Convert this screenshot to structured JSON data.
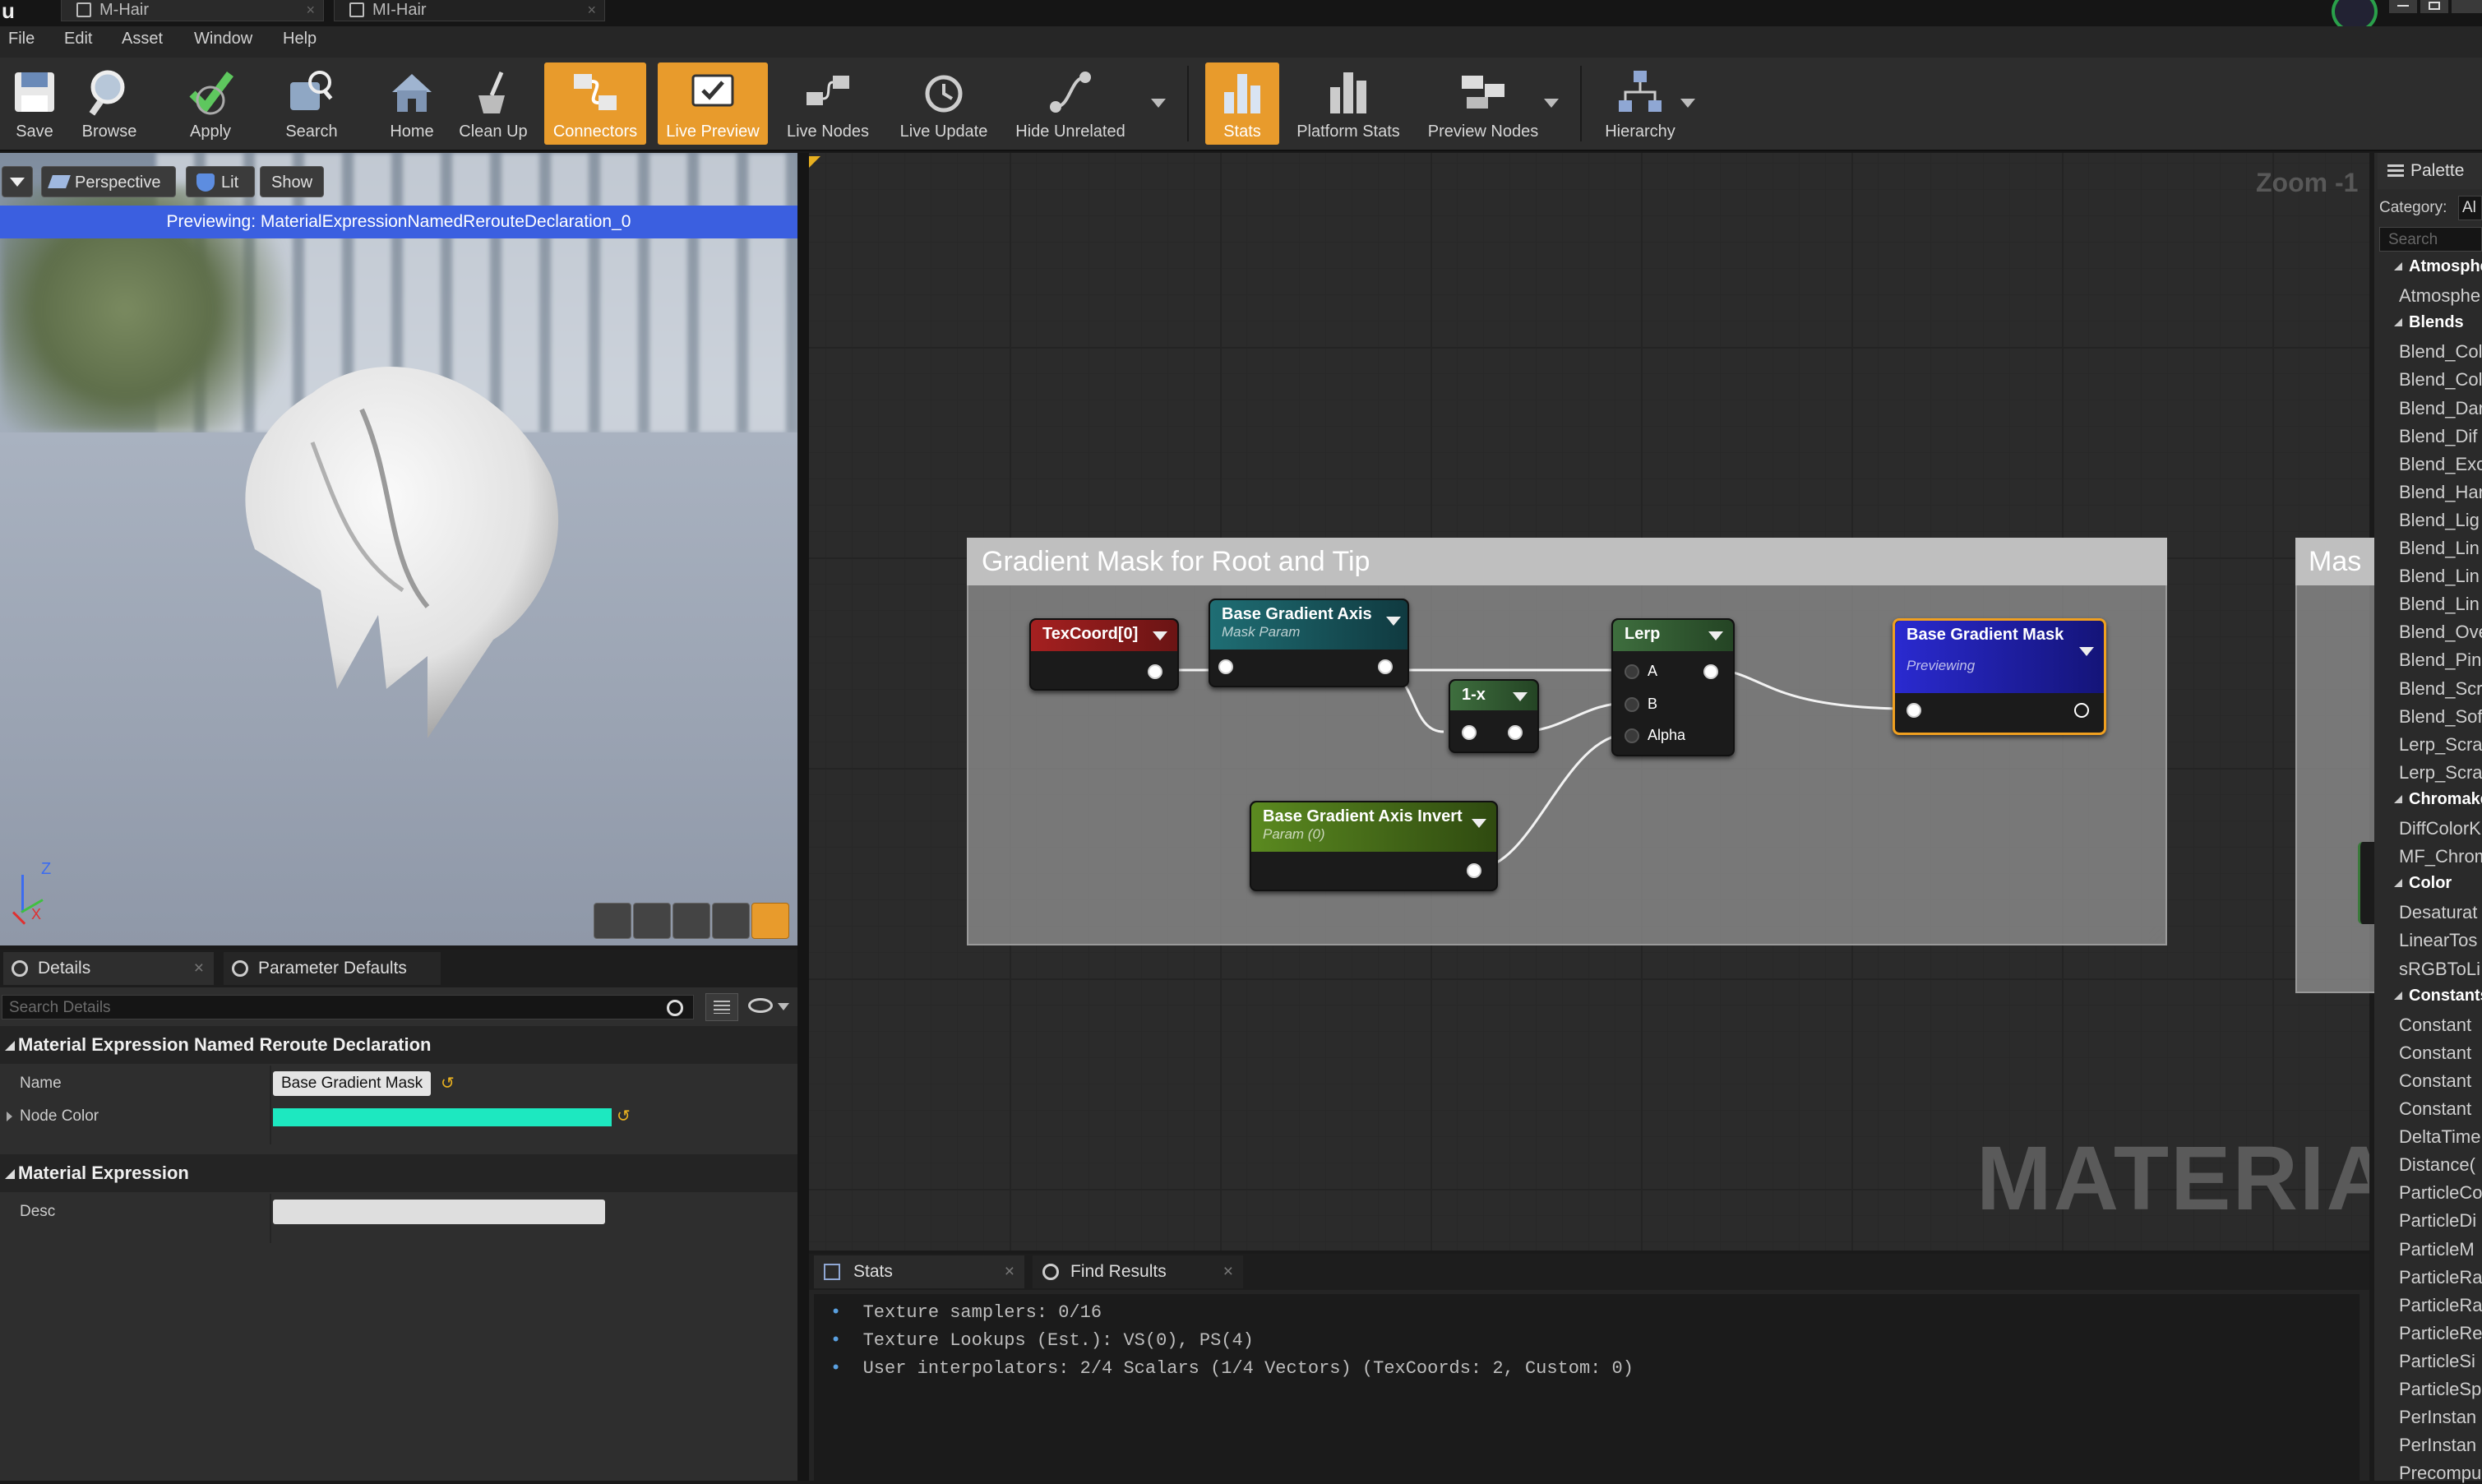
{
  "window": {
    "tabs": [
      "M-Hair",
      "MI-Hair"
    ]
  },
  "menu": [
    "File",
    "Edit",
    "Asset",
    "Window",
    "Help"
  ],
  "toolbar": {
    "items": [
      "Save",
      "Browse",
      "Apply",
      "Search",
      "Home",
      "Clean Up",
      "Connectors",
      "Live Preview",
      "Live Nodes",
      "Live Update",
      "Hide Unrelated",
      "Stats",
      "Platform Stats",
      "Preview Nodes",
      "Hierarchy"
    ],
    "active": [
      "Connectors",
      "Live Preview",
      "Stats"
    ],
    "accent": "#e89b2c"
  },
  "viewport": {
    "perspective": "Perspective",
    "lit": "Lit",
    "show": "Show",
    "previewing": "Previewing: MaterialExpressionNamedRerouteDeclaration_0",
    "axis_z": "Z",
    "axis_x": "X"
  },
  "details": {
    "tab_details": "Details",
    "tab_params": "Parameter Defaults",
    "search_placeholder": "Search Details",
    "cat1": "Material Expression Named Reroute Declaration",
    "name_label": "Name",
    "name_value": "Base Gradient Mask",
    "node_color_label": "Node Color",
    "node_color": "#1de8c0",
    "cat2": "Material Expression",
    "desc_label": "Desc"
  },
  "graph": {
    "zoom": "Zoom -1",
    "watermark": "MATERIAL",
    "comment": "Gradient Mask for Root and Tip",
    "comment2": "Mas",
    "nodes": {
      "texcoord": "TexCoord[0]",
      "bga": "Base Gradient Axis",
      "bga_sub": "Mask Param",
      "onex": "1-x",
      "lerp": "Lerp",
      "lerp_a": "A",
      "lerp_b": "B",
      "lerp_alpha": "Alpha",
      "bgm": "Base Gradient Mask",
      "bgm_sub": "Previewing",
      "bgai": "Base Gradient Axis Invert",
      "bgai_sub": "Param (0)"
    }
  },
  "stats": {
    "tab_stats": "Stats",
    "tab_find": "Find Results",
    "lines": [
      "Texture samplers: 0/16",
      "Texture Lookups (Est.): VS(0), PS(4)",
      "User interpolators: 2/4 Scalars (1/4 Vectors) (TexCoords: 2, Custom: 0)"
    ]
  },
  "palette": {
    "title": "Palette",
    "category_label": "Category:",
    "category_value": "Al",
    "search_placeholder": "Search",
    "entries": [
      {
        "cat": true,
        "t": "Atmosphere"
      },
      {
        "cat": false,
        "t": "Atmosphe"
      },
      {
        "cat": true,
        "t": "Blends"
      },
      {
        "cat": false,
        "t": "Blend_Col"
      },
      {
        "cat": false,
        "t": "Blend_Col"
      },
      {
        "cat": false,
        "t": "Blend_Dar"
      },
      {
        "cat": false,
        "t": "Blend_Dif"
      },
      {
        "cat": false,
        "t": "Blend_Exc"
      },
      {
        "cat": false,
        "t": "Blend_Har"
      },
      {
        "cat": false,
        "t": "Blend_Lig"
      },
      {
        "cat": false,
        "t": "Blend_Lin"
      },
      {
        "cat": false,
        "t": "Blend_Lin"
      },
      {
        "cat": false,
        "t": "Blend_Lin"
      },
      {
        "cat": false,
        "t": "Blend_Ove"
      },
      {
        "cat": false,
        "t": "Blend_Pin"
      },
      {
        "cat": false,
        "t": "Blend_Scr"
      },
      {
        "cat": false,
        "t": "Blend_Sof"
      },
      {
        "cat": false,
        "t": "Lerp_Scra"
      },
      {
        "cat": false,
        "t": "Lerp_Scra"
      },
      {
        "cat": true,
        "t": "Chromakey"
      },
      {
        "cat": false,
        "t": "DiffColorK"
      },
      {
        "cat": false,
        "t": "MF_Chrom"
      },
      {
        "cat": true,
        "t": "Color"
      },
      {
        "cat": false,
        "t": "Desaturat"
      },
      {
        "cat": false,
        "t": "LinearTos"
      },
      {
        "cat": false,
        "t": "sRGBToLi"
      },
      {
        "cat": true,
        "t": "Constants"
      },
      {
        "cat": false,
        "t": "Constant"
      },
      {
        "cat": false,
        "t": "Constant"
      },
      {
        "cat": false,
        "t": "Constant"
      },
      {
        "cat": false,
        "t": "Constant"
      },
      {
        "cat": false,
        "t": "DeltaTime"
      },
      {
        "cat": false,
        "t": "Distance("
      },
      {
        "cat": false,
        "t": "ParticleCo"
      },
      {
        "cat": false,
        "t": "ParticleDi"
      },
      {
        "cat": false,
        "t": "ParticleM"
      },
      {
        "cat": false,
        "t": "ParticleRa"
      },
      {
        "cat": false,
        "t": "ParticleRa"
      },
      {
        "cat": false,
        "t": "ParticleRe"
      },
      {
        "cat": false,
        "t": "ParticleSi"
      },
      {
        "cat": false,
        "t": "ParticleSp"
      },
      {
        "cat": false,
        "t": "PerInstan"
      },
      {
        "cat": false,
        "t": "PerInstan"
      },
      {
        "cat": false,
        "t": "Precompu"
      }
    ]
  }
}
